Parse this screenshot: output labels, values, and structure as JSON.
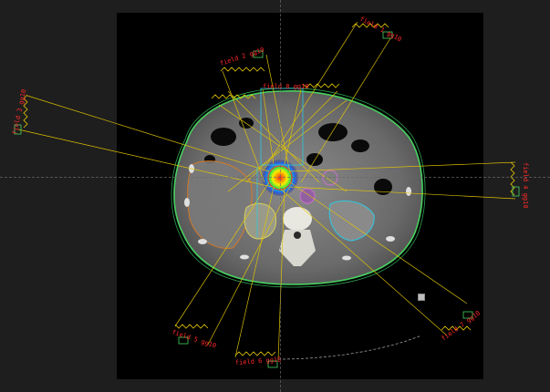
{
  "viewer": {
    "view": "axial-ct-with-beams",
    "colors": {
      "background": "#1e1e1e",
      "image_panel": "#000000",
      "beam_lines": "#e6c800",
      "body_contour": "#48d060",
      "ptv_dose": "#ff2a2a",
      "liver_contour": "#e07a20",
      "kidney_left": "#30c8e0",
      "kidney_right": "#d8d060",
      "spinal_canal": "#c86fd0"
    }
  },
  "beams": [
    {
      "id": "top-right",
      "label": "field 1 gg10"
    },
    {
      "id": "top-left",
      "label": "field 2 gg10"
    },
    {
      "id": "left",
      "label": "field 3 gg10"
    },
    {
      "id": "right",
      "label": "field 4 gg10"
    },
    {
      "id": "bottom-left",
      "label": "field 5 gg10"
    },
    {
      "id": "bottom",
      "label": "field 6 gg10"
    },
    {
      "id": "bottom-right",
      "label": "field 7 gg10"
    },
    {
      "id": "top-center",
      "label": "field 8 gg10"
    }
  ]
}
